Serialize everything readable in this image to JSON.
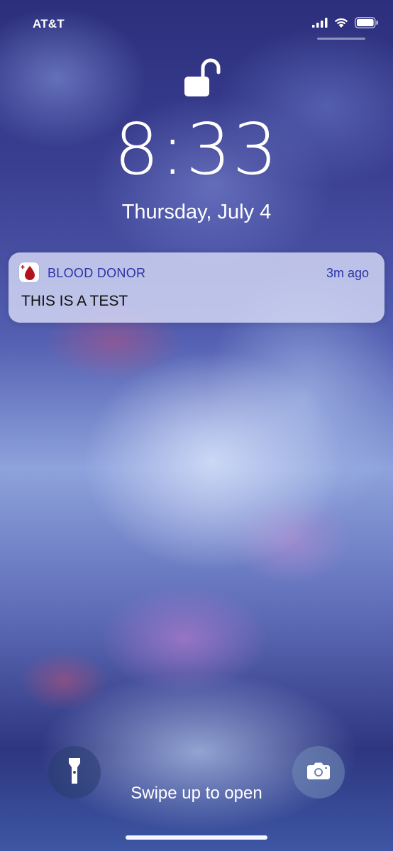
{
  "status_bar": {
    "carrier": "AT&T",
    "signal_icon": "cellular-signal-icon",
    "wifi_icon": "wifi-icon",
    "battery_icon": "battery-icon"
  },
  "lock_screen": {
    "lock_icon": "unlocked-padlock-icon",
    "time": "8:33",
    "date": "Thursday, July 4"
  },
  "notification": {
    "app_icon": "blood-drop-icon",
    "app_name": "BLOOD DONOR",
    "time_ago": "3m ago",
    "body": "THIS IS A TEST",
    "accent_color": "#2b33a6"
  },
  "bottom": {
    "flashlight_icon": "flashlight-icon",
    "camera_icon": "camera-icon",
    "swipe_hint": "Swipe up to open"
  }
}
